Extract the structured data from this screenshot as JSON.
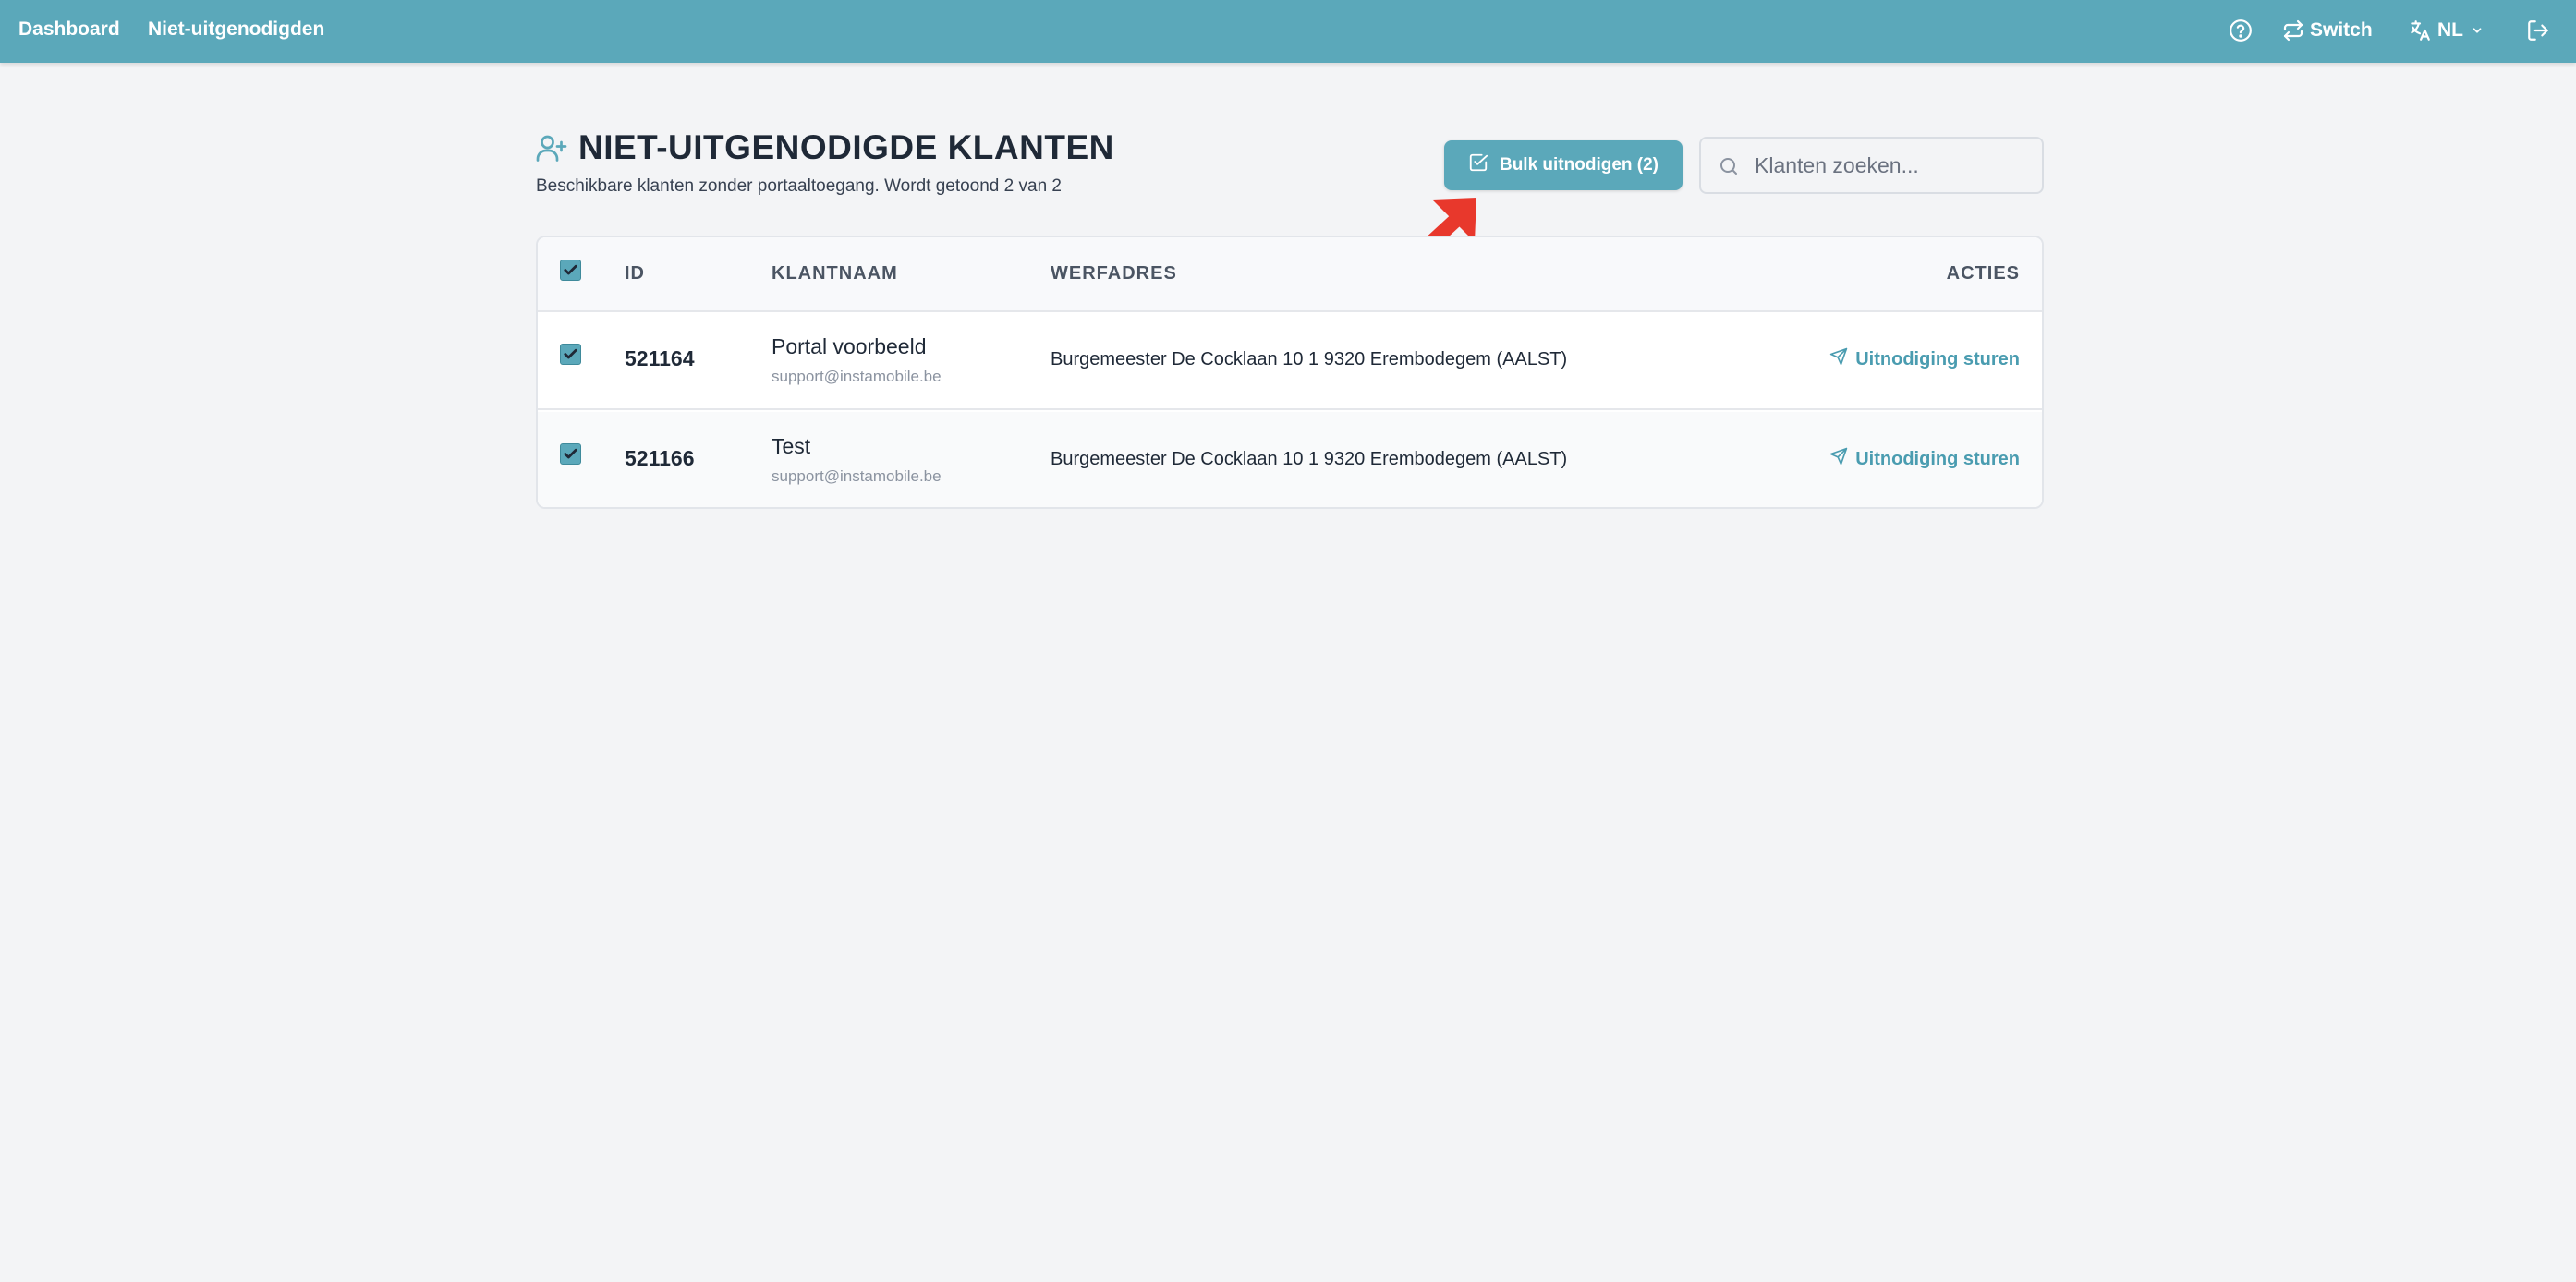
{
  "nav": {
    "dashboard": "Dashboard",
    "uninvited": "Niet-uitgenodigden"
  },
  "topbar": {
    "switch_label": "Switch",
    "language": "NL",
    "icons": [
      "help-icon",
      "switch-icon",
      "translate-icon",
      "chevron-down-icon",
      "logout-icon"
    ]
  },
  "page": {
    "title": "NIET-UITGENODIGDE KLANTEN",
    "subtitle": "Beschikbare klanten zonder portaaltoegang. Wordt getoond 2 van 2",
    "bulk_button": "Bulk uitnodigen (2)",
    "search_placeholder": "Klanten zoeken..."
  },
  "table": {
    "headers": {
      "id": "ID",
      "name": "KLANTNAAM",
      "address": "WERFADRES",
      "actions": "ACTIES"
    },
    "all_selected": true,
    "rows": [
      {
        "selected": true,
        "id": "521164",
        "name": "Portal voorbeeld",
        "email": "support@instamobile.be",
        "address": "Burgemeester De Cocklaan 10 1 9320 Erembodegem (AALST)",
        "action": "Uitnodiging sturen"
      },
      {
        "selected": true,
        "id": "521166",
        "name": "Test",
        "email": "support@instamobile.be",
        "address": "Burgemeester De Cocklaan 10 1 9320 Erembodegem (AALST)",
        "action": "Uitnodiging sturen"
      }
    ]
  },
  "colors": {
    "brand": "#5ba8ba",
    "background": "#f3f4f6",
    "annotation_arrow": "#e8382c"
  }
}
